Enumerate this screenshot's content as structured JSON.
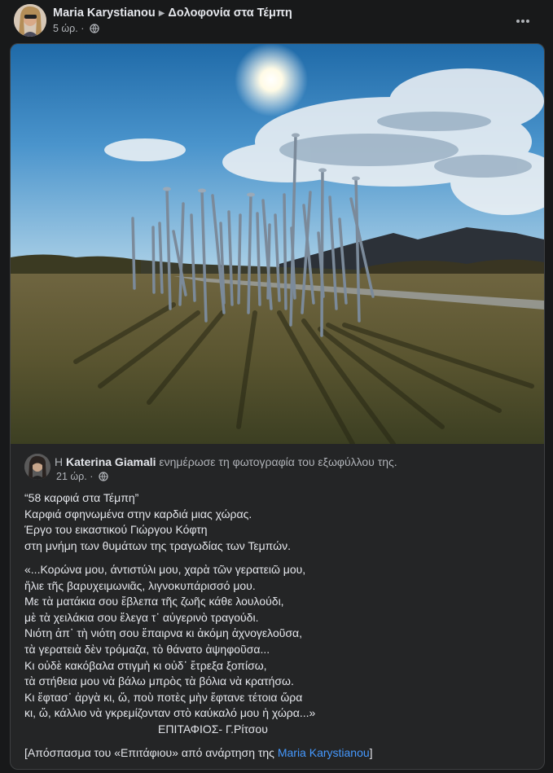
{
  "post": {
    "author": "Maria Karystianou",
    "group": "Δολοφονία στα Τέμπη",
    "time": "5 ώρ. ·",
    "more_icon": "ellipsis-icon",
    "privacy_icon": "globe-icon"
  },
  "shared": {
    "prefix": "Η",
    "author": "Katerina Giamali",
    "action": "ενημέρωσε τη φωτογραφία του εξωφύλλου της.",
    "time": "21 ώρ. ·"
  },
  "caption": {
    "intro": [
      "“58 καρφιά στα Τέμπη”",
      "Καρφιά σφηνωμένα στην καρδιά μιας χώρας.",
      "Έργο του εικαστικού Γιώργου Κόφτη",
      "στη μνήμη των θυμάτων της τραγωδίας των Τεμπών."
    ],
    "poem": [
      "«...Κορώνα μου, άντιστύλι μου, χαρὰ τῶν γερατειῶ μου,",
      "ἥλιε τῆς βαρυχειμωνιᾶς, λιγνοκυπάρισσό μου.",
      "Με τὰ ματάκια σου ἔβλεπα τῆς ζωῆς κάθε λουλούδι,",
      "μὲ τὰ χειλάκια σου ἔλεγα τ᾽ αὐγερινὸ τραγούδι.",
      "Νιότη ἀπ᾽ τὴ νιότη σου ἔπαιρνα κι ἀκόμη ἀχνογελοῦσα,",
      "τὰ γερατειὰ δὲν τρόμαζα, τὸ θάνατο ἀψηφοῦσα...",
      "Κι οὐδὲ κακόβαλα στιγμὴ κι οὐδ᾽ ἔτρεξα ξοπίσω,",
      "τὰ στήθεια μου νὰ βάλω μπρὸς τὰ βόλια νὰ κρατήσω.",
      "Κι ἔφτασ᾽ ἀργὰ κι, ὤ, ποὺ ποτὲς μὴν ἔφτανε τέτοια ὥρα",
      "κι, ὤ, κάλλιο νὰ γκρεμίζονταν στὸ καύκαλό μου ἡ χώρα...»"
    ],
    "signature": "ΕΠΙΤΑΦΙΟΣ- Γ.Ρίτσου",
    "footer_prefix": "[Απόσπασμα του «Επιτάφιου» από ανάρτηση της",
    "footer_link": "Maria Karystianou",
    "footer_suffix": "]"
  }
}
